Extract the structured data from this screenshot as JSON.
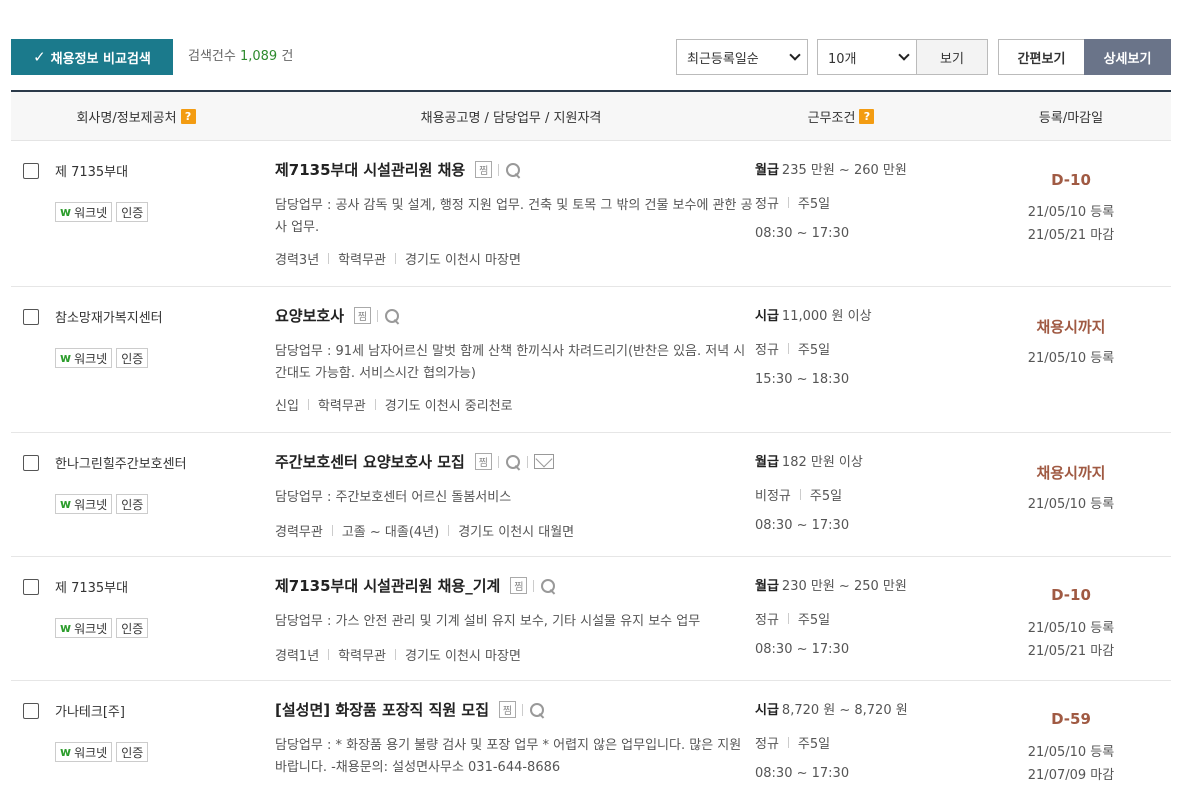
{
  "toolbar": {
    "compare_label": "채용정보 비교검색",
    "count_prefix": "검색건수",
    "count_value": "1,089",
    "count_suffix": "건",
    "sort_value": "최근등록일순",
    "size_value": "10개",
    "view_label": "보기",
    "simple_label": "간편보기",
    "detail_label": "상세보기"
  },
  "header": {
    "company": "회사명/정보제공처",
    "title": "채용공고명 / 담당업무 / 지원자격",
    "conditions": "근무조건",
    "dates": "등록/마감일",
    "help": "?"
  },
  "badges": {
    "worknet": "워크넷",
    "worknet_mark": "w",
    "cert": "인증",
    "scrap": "찜"
  },
  "rows": [
    {
      "company": "제 7135부대",
      "title": "제7135부대 시설관리원 채용",
      "duty": "담당업무 : 공사 감독 및 설계, 행정 지원 업무. 건축 및 토목 그 밖의 건물 보수에 관한 공사 업무.",
      "career": "경력3년",
      "education": "학력무관",
      "location": "경기도 이천시 마장면",
      "pay_type": "월급",
      "pay": "235 만원 ~ 260 만원",
      "employment": "정규",
      "days": "주5일",
      "hours": "08:30 ~ 17:30",
      "dday": "D-10",
      "registered": "21/05/10 등록",
      "deadline": "21/05/21 마감"
    },
    {
      "company": "참소망재가복지센터",
      "title": "요양보호사",
      "duty": "담당업무 : 91세 남자어르신 말벗 함께 산책 한끼식사 차려드리기(반찬은 있음. 저녁 시간대도 가능함. 서비스시간 협의가능)",
      "career": "신입",
      "education": "학력무관",
      "location": "경기도 이천시 중리천로",
      "pay_type": "시급",
      "pay": "11,000 원 이상",
      "employment": "정규",
      "days": "주5일",
      "hours": "15:30 ~ 18:30",
      "dday": "채용시까지",
      "registered": "21/05/10 등록",
      "deadline": ""
    },
    {
      "company": "한나그린힐주간보호센터",
      "title": "주간보호센터 요양보호사 모집",
      "duty": "담당업무 : 주간보호센터 어르신 돌봄서비스",
      "career": "경력무관",
      "education": "고졸 ~ 대졸(4년)",
      "location": "경기도 이천시 대월면",
      "pay_type": "월급",
      "pay": "182 만원 이상",
      "employment": "비정규",
      "days": "주5일",
      "hours": "08:30 ~ 17:30",
      "dday": "채용시까지",
      "registered": "21/05/10 등록",
      "deadline": ""
    },
    {
      "company": "제 7135부대",
      "title": "제7135부대 시설관리원 채용_기계",
      "duty": "담당업무 : 가스 안전 관리 및 기계 설비 유지 보수, 기타 시설물 유지 보수 업무",
      "career": "경력1년",
      "education": "학력무관",
      "location": "경기도 이천시 마장면",
      "pay_type": "월급",
      "pay": "230 만원 ~ 250 만원",
      "employment": "정규",
      "days": "주5일",
      "hours": "08:30 ~ 17:30",
      "dday": "D-10",
      "registered": "21/05/10 등록",
      "deadline": "21/05/21 마감"
    },
    {
      "company": "가나테크[주]",
      "title": "[설성면] 화장품 포장직 직원 모집",
      "duty": "담당업무 : * 화장품 용기 불량 검사 및 포장 업무 * 어렵지 않은 업무입니다. 많은 지원 바랍니다. -채용문의: 설성면사무소 031-644-8686",
      "career": "",
      "education": "",
      "location": "",
      "pay_type": "시급",
      "pay": "8,720 원 ~ 8,720 원",
      "employment": "정규",
      "days": "주5일",
      "hours": "08:30 ~ 17:30",
      "dday": "D-59",
      "registered": "21/05/10 등록",
      "deadline": "21/07/09 마감"
    }
  ]
}
